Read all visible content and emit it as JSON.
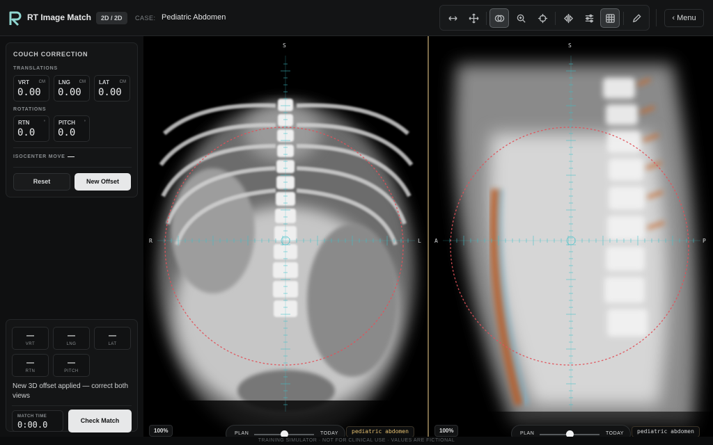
{
  "header": {
    "app_title": "RT Image Match",
    "mode_badge": "2D / 2D",
    "case_label": "CASE:",
    "case_name": "Pediatric Abdomen",
    "menu_label": "‹ Menu"
  },
  "toolbar": {
    "tools": [
      {
        "icon": "horizontal-arrows-icon"
      },
      {
        "icon": "move-arrows-icon"
      },
      {
        "icon": "overlay-circles-icon",
        "active": true
      },
      {
        "icon": "zoom-in-icon"
      },
      {
        "icon": "crosshair-icon"
      },
      {
        "icon": "mirror-flip-icon"
      },
      {
        "icon": "sliders-icon"
      },
      {
        "icon": "grid-icon",
        "active": true
      },
      {
        "icon": "pencil-icon"
      }
    ]
  },
  "couch": {
    "title": "COUCH CORRECTION",
    "translations_label": "TRANSLATIONS",
    "rotations_label": "ROTATIONS",
    "translations": [
      {
        "label": "VRT",
        "unit": "CM",
        "value": "0.00"
      },
      {
        "label": "LNG",
        "unit": "CM",
        "value": "0.00"
      },
      {
        "label": "LAT",
        "unit": "CM",
        "value": "0.00"
      }
    ],
    "rotations": [
      {
        "label": "RTN",
        "unit": "°",
        "value": "0.0"
      },
      {
        "label": "PITCH",
        "unit": "°",
        "value": "0.0"
      }
    ],
    "isocenter_label": "ISOCENTER MOVE",
    "isocenter_value": "—",
    "reset_label": "Reset",
    "new_offset_label": "New Offset"
  },
  "status": {
    "cells": [
      {
        "value": "—",
        "label": "VRT"
      },
      {
        "value": "—",
        "label": "LNG"
      },
      {
        "value": "—",
        "label": "LAT"
      },
      {
        "value": "—",
        "label": "RTN"
      },
      {
        "value": "—",
        "label": "PITCH"
      }
    ],
    "message": "New 3D offset applied — correct both views",
    "match_time_label": "MATCH TIME",
    "match_time_value": "0:00.0",
    "check_label": "Check Match"
  },
  "views": [
    {
      "top": "S",
      "left": "R",
      "right": "L",
      "zoom": "100%",
      "plan": "PLAN",
      "today": "TODAY",
      "blend": 0.5,
      "case_label": "pediatric abdomen"
    },
    {
      "top": "S",
      "left": "A",
      "right": "P",
      "zoom": "100%",
      "plan": "PLAN",
      "today": "TODAY",
      "blend": 0.5,
      "case_label": "pediatric abdomen"
    }
  ],
  "footer": "TRAINING SIMULATOR · NOT FOR CLINICAL USE · VALUES ARE FICTIONAL",
  "colors": {
    "accent_teal": "#3fc1c9",
    "match_circle": "#e0525a",
    "case_label_gold": "#e6c071",
    "case_label_light": "#d6d8d9"
  }
}
